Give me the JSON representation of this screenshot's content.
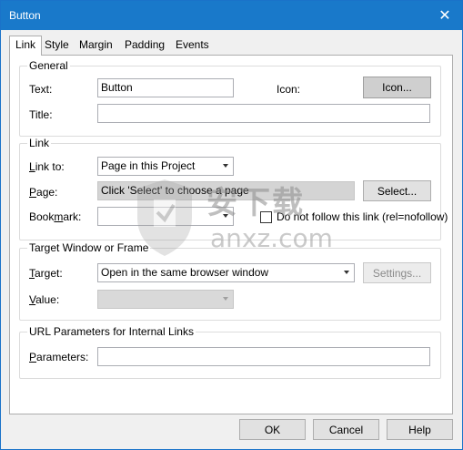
{
  "window": {
    "title": "Button",
    "close_glyph": "✕"
  },
  "tabs": [
    {
      "label": "Link"
    },
    {
      "label": "Style"
    },
    {
      "label": "Margin"
    },
    {
      "label": "Padding"
    },
    {
      "label": "Events"
    }
  ],
  "general": {
    "title": "General",
    "text_label": "Text:",
    "text_value": "Button",
    "icon_label": "Icon:",
    "icon_button": "Icon...",
    "title_label": "Title:",
    "title_value": ""
  },
  "link": {
    "title": "Link",
    "link_to_label": "Link to:",
    "link_to_value": "Page in this Project",
    "page_label": "Page:",
    "page_value": "Click 'Select' to choose a page",
    "select_button": "Select...",
    "bookmark_label": "Bookmark:",
    "bookmark_value": "",
    "nofollow_label": "Do not follow this link (rel=nofollow)",
    "nofollow_checked": false
  },
  "target": {
    "title": "Target Window or Frame",
    "target_label": "Target:",
    "target_value": "Open in the same browser window",
    "settings_button": "Settings...",
    "value_label": "Value:",
    "value_value": ""
  },
  "url_params": {
    "title": "URL Parameters for Internal Links",
    "parameters_label": "Parameters:",
    "parameters_value": ""
  },
  "footer": {
    "ok": "OK",
    "cancel": "Cancel",
    "help": "Help"
  },
  "watermark": {
    "text_main": "安下载",
    "text_sub": "anxz.com"
  },
  "colors": {
    "titlebar": "#1979ca",
    "dialog_bg": "#f0f0f0",
    "panel_bg": "#ffffff"
  }
}
